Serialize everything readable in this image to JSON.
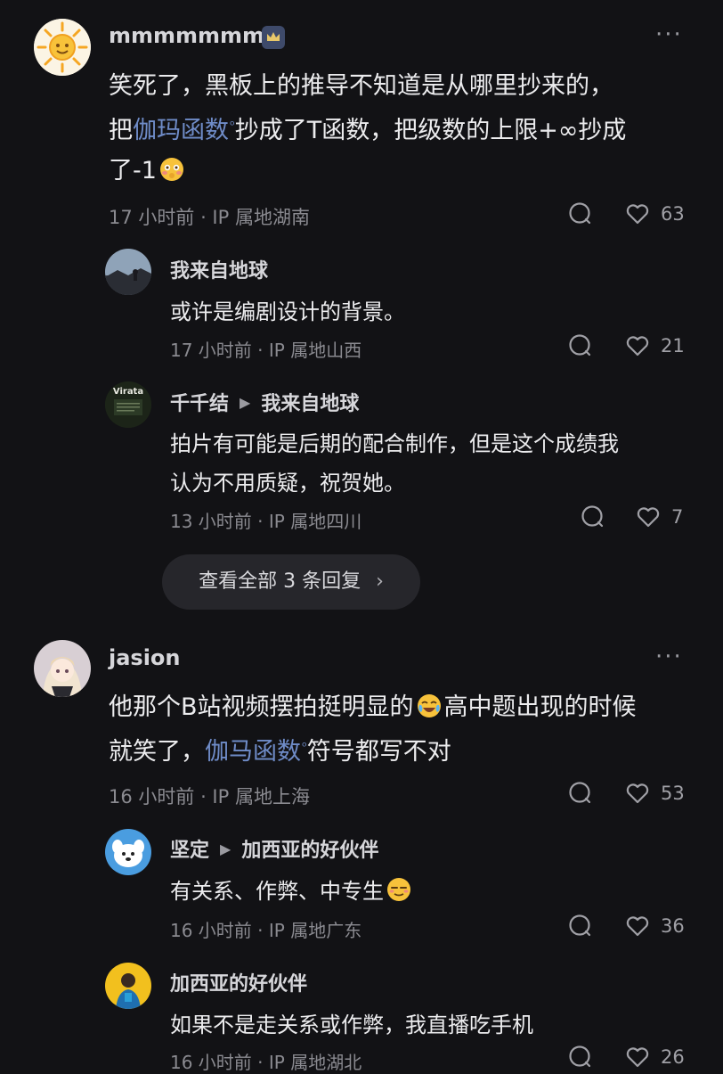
{
  "comments": [
    {
      "user": "mmmmmmm",
      "text_line1": "笑死了，黑板上的推导不知道是从哪里抄来的，",
      "text_line2_pre": "把",
      "text_line2_link": "伽玛函数",
      "text_line2_post": "抄成了T函数，把级数的上限+∞抄成",
      "text_line3": "了-1",
      "meta": "17 小时前 · IP 属地湖南",
      "likes": "63",
      "more": "···",
      "replies": [
        {
          "user": "我来自地球",
          "text": "或许是编剧设计的背景。",
          "meta": "17 小时前 · IP 属地山西",
          "likes": "21"
        },
        {
          "user": "千千结",
          "reply_to": "我来自地球",
          "avatar_text": "Virata",
          "text_line1": "拍片有可能是后期的配合制作，但是这个成绩我",
          "text_line2": "认为不用质疑，祝贺她。",
          "meta": "13 小时前 · IP 属地四川",
          "likes": "7"
        }
      ],
      "view_all": "查看全部 3 条回复"
    },
    {
      "user": "jasion",
      "text_line1_pre": "他那个B站视频摆拍挺明显的",
      "text_line1_post": "高中题出现的时候",
      "text_line2_pre": "就笑了，",
      "text_line2_link": "伽马函数",
      "text_line2_post": "符号都写不对",
      "meta": "16 小时前 · IP 属地上海",
      "likes": "53",
      "more": "···",
      "replies": [
        {
          "user": "坚定",
          "reply_to": "加西亚的好伙伴",
          "text": "有关系、作弊、中专生",
          "meta": "16 小时前 · IP 属地广东",
          "likes": "36"
        },
        {
          "user": "加西亚的好伙伴",
          "text": "如果不是走关系或作弊，我直播吃手机",
          "meta": "16 小时前 · IP 属地湖北",
          "likes": "26"
        }
      ]
    }
  ],
  "colors": {
    "background": "#121215",
    "link": "#6f8cc8",
    "meta": "#8a8a90"
  }
}
